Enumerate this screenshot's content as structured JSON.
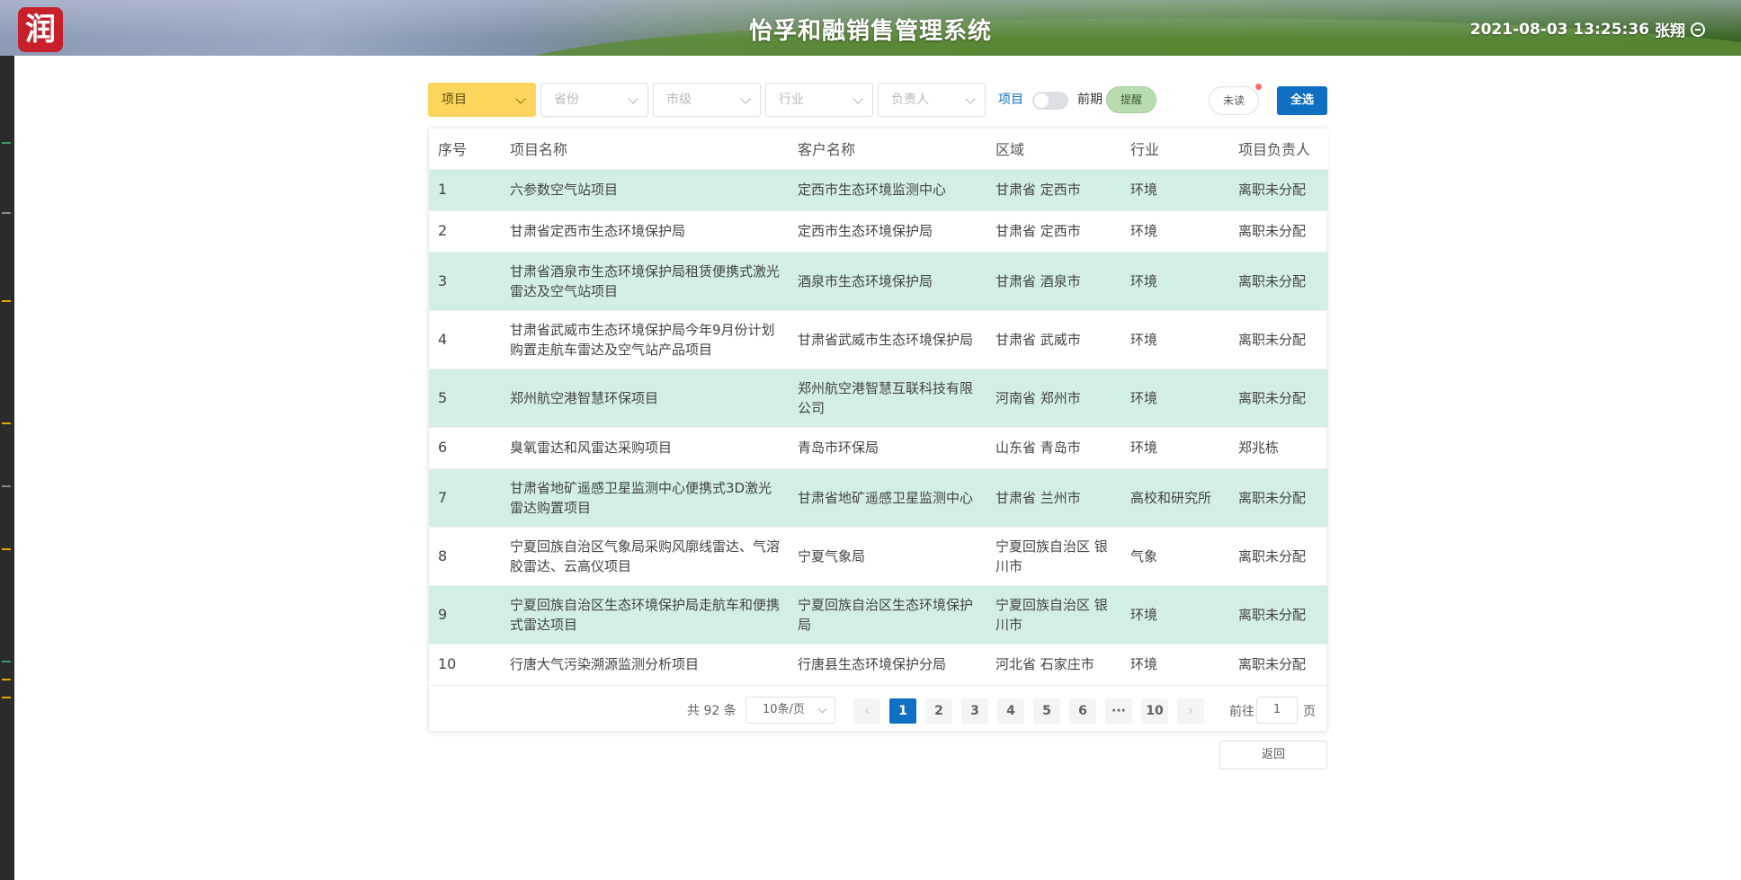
{
  "header": {
    "logo_char": "润",
    "title": "怡孚和融销售管理系统",
    "datetime": "2021-08-03 13:25:36",
    "user": "张翔"
  },
  "filters": {
    "type_select": "项目",
    "province_placeholder": "省份",
    "city_placeholder": "市级",
    "industry_placeholder": "行业",
    "owner_placeholder": "负责人",
    "toggle_left": "项目",
    "toggle_right": "前期",
    "remind_label": "提醒",
    "unread_label": "未读",
    "all_label": "全选"
  },
  "table": {
    "columns": [
      "序号",
      "项目名称",
      "客户名称",
      "区域",
      "行业",
      "项目负责人"
    ],
    "rows": [
      [
        "1",
        "六参数空气站项目",
        "定西市生态环境监测中心",
        "甘肃省 定西市",
        "环境",
        "离职未分配"
      ],
      [
        "2",
        "甘肃省定西市生态环境保护局",
        "定西市生态环境保护局",
        "甘肃省 定西市",
        "环境",
        "离职未分配"
      ],
      [
        "3",
        "甘肃省酒泉市生态环境保护局租赁便携式激光雷达及空气站项目",
        "酒泉市生态环境保护局",
        "甘肃省 酒泉市",
        "环境",
        "离职未分配"
      ],
      [
        "4",
        "甘肃省武威市生态环境保护局今年9月份计划购置走航车雷达及空气站产品项目",
        "甘肃省武威市生态环境保护局",
        "甘肃省 武威市",
        "环境",
        "离职未分配"
      ],
      [
        "5",
        "郑州航空港智慧环保项目",
        "郑州航空港智慧互联科技有限公司",
        "河南省 郑州市",
        "环境",
        "离职未分配"
      ],
      [
        "6",
        "臭氧雷达和风雷达采购项目",
        "青岛市环保局",
        "山东省 青岛市",
        "环境",
        "郑兆栋"
      ],
      [
        "7",
        "甘肃省地矿遥感卫星监测中心便携式3D激光雷达购置项目",
        "甘肃省地矿遥感卫星监测中心",
        "甘肃省 兰州市",
        "高校和研究所",
        "离职未分配"
      ],
      [
        "8",
        "宁夏回族自治区气象局采购风廓线雷达、气溶胶雷达、云高仪项目",
        "宁夏气象局",
        "宁夏回族自治区 银川市",
        "气象",
        "离职未分配"
      ],
      [
        "9",
        "宁夏回族自治区生态环境保护局走航车和便携式雷达项目",
        "宁夏回族自治区生态环境保护局",
        "宁夏回族自治区 银川市",
        "环境",
        "离职未分配"
      ],
      [
        "10",
        "行唐大气污染溯源监测分析项目",
        "行唐县生态环境保护分局",
        "河北省 石家庄市",
        "环境",
        "离职未分配"
      ]
    ]
  },
  "pagination": {
    "total": "共 92 条",
    "page_size": "10条/页",
    "pages": [
      "1",
      "2",
      "3",
      "4",
      "5",
      "6",
      "···",
      "10"
    ],
    "current": "1",
    "prev": "‹",
    "next": "›",
    "goto_label": "前往",
    "goto_value": "1",
    "goto_suffix": "页"
  },
  "back_label": "返回",
  "colors": {
    "accent_blue": "#0f6fc2",
    "active_select": "#fcd55c",
    "row_alt": "#d3efe4",
    "brand_red": "#c8202b"
  }
}
